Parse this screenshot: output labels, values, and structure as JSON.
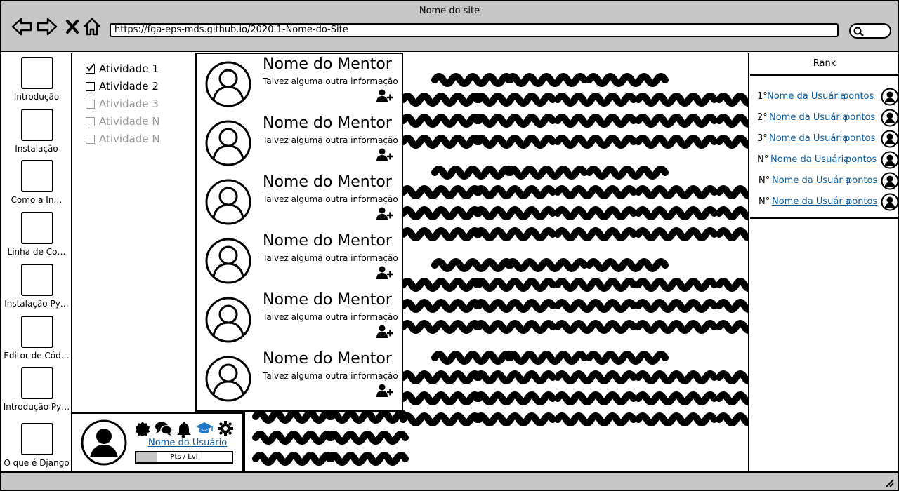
{
  "window": {
    "title": "Nome do site",
    "url": "https://fga-eps-mds.github.io/2020.1-Nome-do-Site"
  },
  "modules": [
    {
      "label": "Introdução"
    },
    {
      "label": "Instalação"
    },
    {
      "label": "Como a In…"
    },
    {
      "label": "Linha de Co…"
    },
    {
      "label": "Instalação Py…"
    },
    {
      "label": "Editor de Cód…"
    },
    {
      "label": "Introdução Py…"
    },
    {
      "label": "O que é Django"
    }
  ],
  "activities": [
    {
      "label": "Atividade 1",
      "checked": true,
      "enabled": true
    },
    {
      "label": "Atividade 2",
      "checked": false,
      "enabled": true
    },
    {
      "label": "Atividade 3",
      "checked": false,
      "enabled": false
    },
    {
      "label": "Atividade N",
      "checked": false,
      "enabled": false
    },
    {
      "label": "Atividade N",
      "checked": false,
      "enabled": false
    }
  ],
  "mentors": [
    {
      "name": "Nome do Mentor",
      "info": "Talvez alguma outra informação"
    },
    {
      "name": "Nome do Mentor",
      "info": "Talvez alguma outra informação"
    },
    {
      "name": "Nome do Mentor",
      "info": "Talvez alguma outra informação"
    },
    {
      "name": "Nome do Mentor",
      "info": "Talvez alguma outra informação"
    },
    {
      "name": "Nome do Mentor",
      "info": "Talvez alguma outra informação"
    },
    {
      "name": "Nome do Mentor",
      "info": "Talvez alguma outra informação"
    }
  ],
  "user": {
    "name": "Nome do Usuário",
    "progress_label": "Pts / Lvl",
    "progress": 0.22,
    "icons": [
      "badge-icon",
      "chat-icon",
      "bell-icon",
      "graduation-cap-icon",
      "gear-icon"
    ]
  },
  "rank": {
    "title": "Rank",
    "rows": [
      {
        "pos": "1°",
        "name": "Nome da Usuária",
        "points": "pontos"
      },
      {
        "pos": "2°",
        "name": "Nome da Usuária",
        "points": "pontos"
      },
      {
        "pos": "3°",
        "name": "Nome da Usuária",
        "points": "pontos"
      },
      {
        "pos": "N°",
        "name": "Nome da Usuária",
        "points": "pontos"
      },
      {
        "pos": "N°",
        "name": "Nome da Usuária",
        "points": "pontos"
      },
      {
        "pos": "N°",
        "name": "Nome da Usuária",
        "points": "pontos"
      }
    ]
  },
  "colors": {
    "chrome": "#c6c6c6",
    "link": "#0b5a9e",
    "accent_icon": "#1e78c8"
  }
}
